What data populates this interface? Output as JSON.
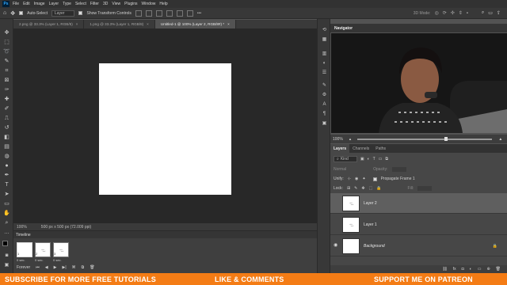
{
  "menubar": {
    "logo": "Ps",
    "items": [
      "File",
      "Edit",
      "Image",
      "Layer",
      "Type",
      "Select",
      "Filter",
      "3D",
      "View",
      "Plugins",
      "Window",
      "Help"
    ]
  },
  "options": {
    "auto_select": "Auto-Select",
    "auto_select_target": "Layer",
    "show_transform": "Show Transform Controls",
    "mode_3d": "3D Mode:"
  },
  "tabs": [
    {
      "label": "2.png @ 33.3% (Layer 1, RGB/8)",
      "active": false
    },
    {
      "label": "1.png @ 33.3% (Layer 1, RGB/8)",
      "active": false
    },
    {
      "label": "Untitled-1 @ 100% (Layer 2, RGB/8#) *",
      "active": true
    }
  ],
  "status": {
    "zoom": "100%",
    "doc_info": "500 px x 500 px (72.009 ppi)"
  },
  "timeline": {
    "title": "Timeline",
    "frames": [
      {
        "number": "1",
        "delay": "0 sec.",
        "selected": true
      },
      {
        "number": "2",
        "delay": "0 sec.",
        "selected": false
      },
      {
        "number": "3",
        "delay": "0 sec.",
        "selected": false
      }
    ],
    "loop": "Forever"
  },
  "navigator": {
    "title": "Navigator",
    "zoom": "100%",
    "zoom_level": 0.66
  },
  "layers": {
    "tabs": [
      "Layers",
      "Channels",
      "Paths"
    ],
    "filter_kind": "Kind",
    "blend_mode": "Normal",
    "opacity_label": "Opacity:",
    "unify_label": "Unify:",
    "propagate_label": "Propagate Frame 1",
    "lock_label": "Lock:",
    "fill_label": "Fill:",
    "items": [
      {
        "name": "Layer 2",
        "active": true,
        "visible": false,
        "italic": false
      },
      {
        "name": "Layer 1",
        "active": false,
        "visible": false,
        "italic": false
      },
      {
        "name": "Background",
        "active": false,
        "visible": true,
        "italic": true
      }
    ]
  },
  "banner": {
    "left": "SUBSCRIBE FOR MORE FREE TUTORIALS",
    "middle": "LIKE & COMMENTS",
    "right": "SUPPORT ME ON PATREON"
  },
  "colors": {
    "banner": "#f47c15",
    "workspace": "#535353",
    "canvas_bg": "#282828"
  }
}
